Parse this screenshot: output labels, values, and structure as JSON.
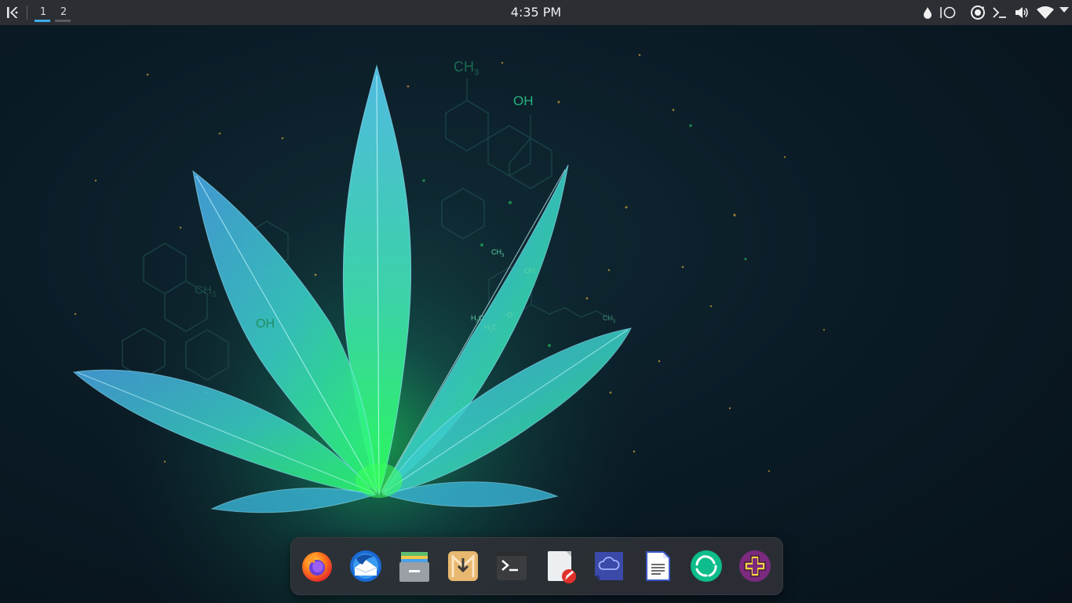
{
  "panel": {
    "launcher_icon": "kde-logo-icon",
    "pager": [
      {
        "label": "1",
        "active": true
      },
      {
        "label": "2",
        "active": false
      }
    ],
    "clock": "4:35 PM",
    "tray": {
      "icons": [
        "droplet-icon",
        "night-color-toggle-icon",
        "update-notifier-icon",
        "terminal-icon",
        "volume-icon",
        "wifi-icon",
        "expand-arrow-icon"
      ]
    }
  },
  "wallpaper": {
    "labels": {
      "ch3_top": "CH",
      "ch3_top_sub": "3",
      "oh_top": "OH",
      "ch3_left": "CH",
      "ch3_left_sub": "3",
      "oh_left": "OH",
      "ch3_small": "CH",
      "ch3_small_sub": "3",
      "oh_small": "OH",
      "h3c": "H",
      "h3c_sub": "3",
      "h3c_c": "C",
      "h3c_2": "H",
      "h3c_2_sub": "3",
      "h3c_2_c": "C",
      "o_small": "O",
      "ch3_right": "CH",
      "ch3_right_sub": "3"
    },
    "colors": {
      "leaf_core": "#25f06a",
      "leaf_edge": "#3fd0f0",
      "hex": "#1c3a40"
    }
  },
  "dock": {
    "items": [
      {
        "icon": "firefox-icon",
        "app": "Firefox"
      },
      {
        "icon": "thunderbird-icon",
        "app": "Thunderbird"
      },
      {
        "icon": "archive-manager-icon",
        "app": "Archive Manager"
      },
      {
        "icon": "download-manager-icon",
        "app": "Download Manager"
      },
      {
        "icon": "terminal-app-icon",
        "app": "Terminal"
      },
      {
        "icon": "text-editor-icon",
        "app": "Text Editor"
      },
      {
        "icon": "cloud-sync-icon",
        "app": "Cloud Sync"
      },
      {
        "icon": "document-writer-icon",
        "app": "Writer"
      },
      {
        "icon": "element-chat-icon",
        "app": "Element"
      },
      {
        "icon": "system-tools-icon",
        "app": "Tools"
      }
    ]
  }
}
